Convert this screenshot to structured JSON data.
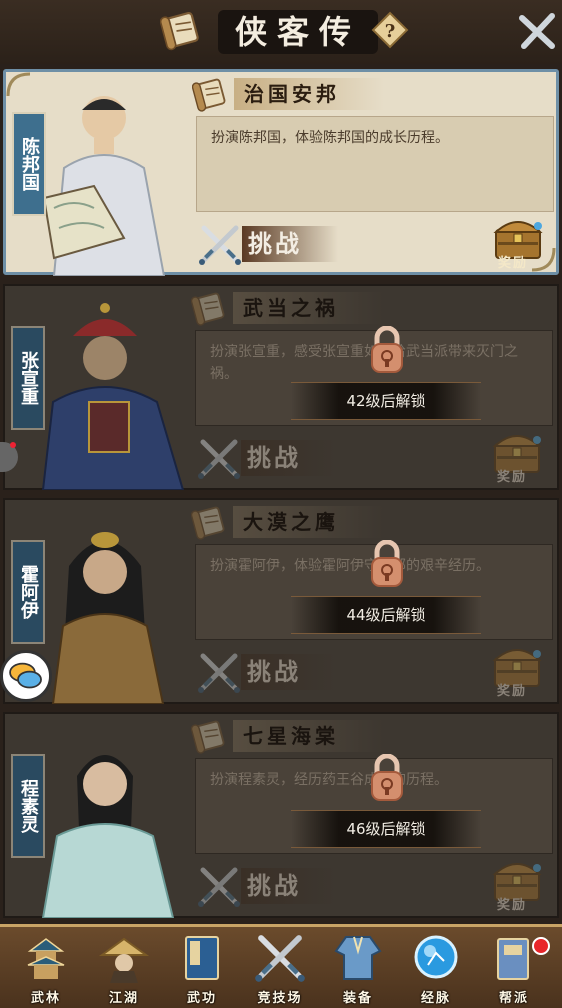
{
  "header": {
    "title": "侠客传",
    "help_label": "?",
    "close_label": "close"
  },
  "cards": [
    {
      "character": "陈邦国",
      "stage_title": "治国安邦",
      "description": "扮演陈邦国，体验陈邦国的成长历程。",
      "challenge_label": "挑战",
      "reward_label": "奖励",
      "locked": false,
      "unlock_text": ""
    },
    {
      "character": "张宣重",
      "stage_title": "武当之祸",
      "description": "扮演张宣重，感受张宣重如何给武当派带来灭门之祸。",
      "challenge_label": "挑战",
      "reward_label": "奖励",
      "locked": true,
      "unlock_text": "42级后解锁"
    },
    {
      "character": "霍阿伊",
      "stage_title": "大漠之鹰",
      "description": "扮演霍阿伊，体验霍阿伊守回部的艰辛经历。",
      "challenge_label": "挑战",
      "reward_label": "奖励",
      "locked": true,
      "unlock_text": "44级后解锁"
    },
    {
      "character": "程素灵",
      "stage_title": "七星海棠",
      "description": "扮演程素灵，经历药王谷成长的历程。",
      "challenge_label": "挑战",
      "reward_label": "奖励",
      "locked": true,
      "unlock_text": "46级后解锁"
    }
  ],
  "nav": [
    {
      "label": "武林",
      "icon": "pagoda-icon"
    },
    {
      "label": "江湖",
      "icon": "straw-hat-icon"
    },
    {
      "label": "武功",
      "icon": "book-icon"
    },
    {
      "label": "竞技场",
      "icon": "crossed-swords-icon"
    },
    {
      "label": "装备",
      "icon": "robe-icon"
    },
    {
      "label": "经脉",
      "icon": "meridian-orb-icon"
    },
    {
      "label": "帮派",
      "icon": "guild-scroll-icon",
      "badge": true
    }
  ],
  "colors": {
    "active_border": "#6e8fa6",
    "name_tag": "#3e6f8e",
    "badge": "#e8262a"
  }
}
